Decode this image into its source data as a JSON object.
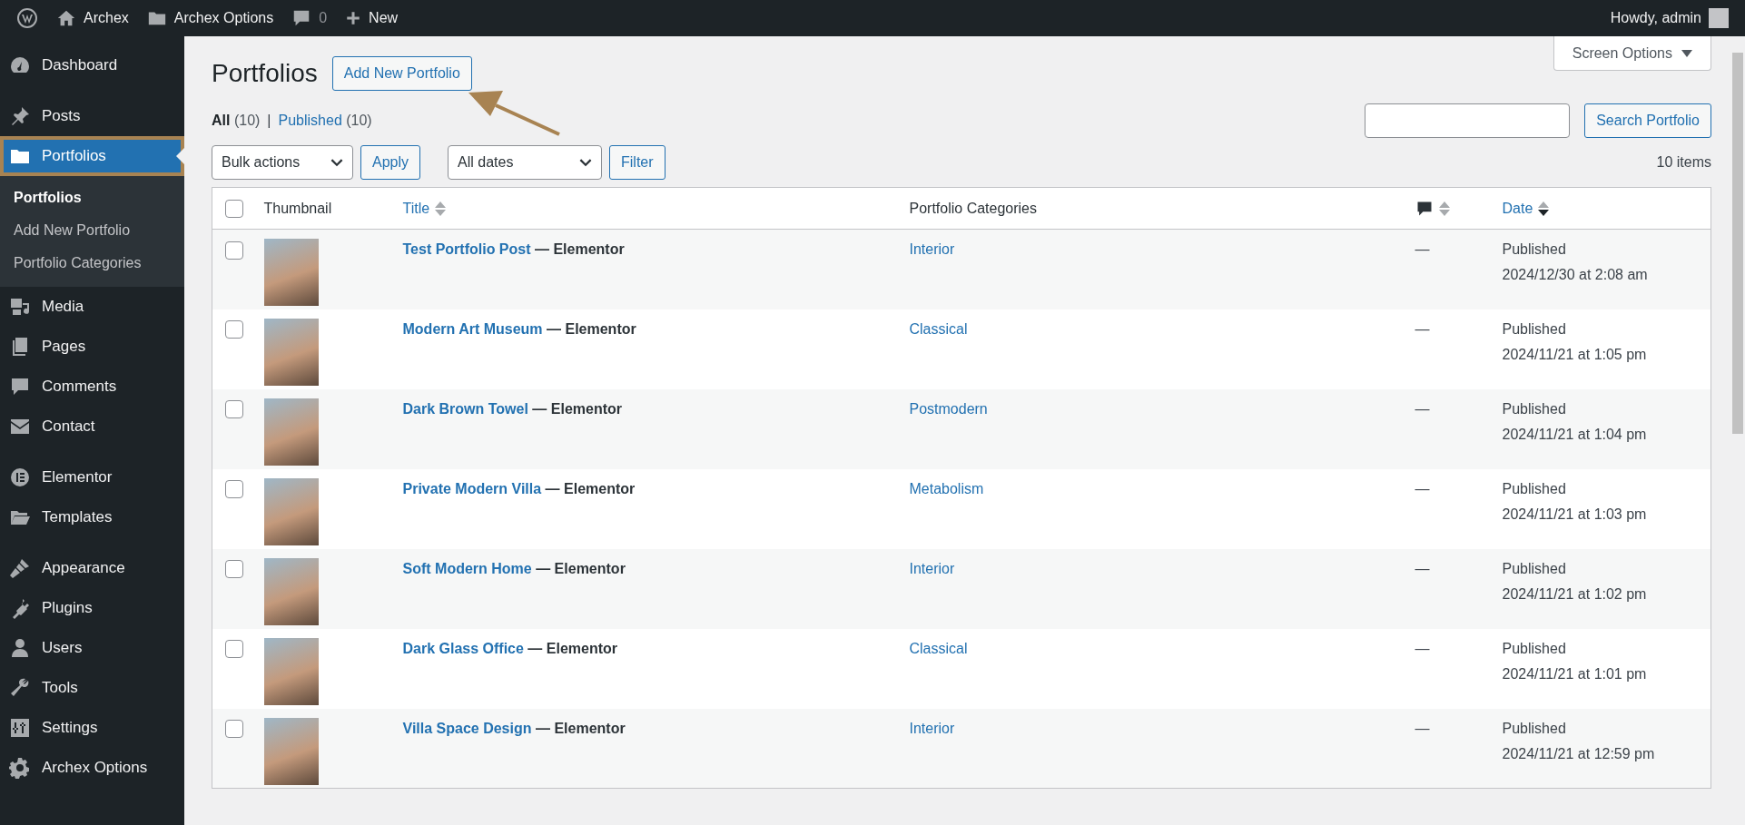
{
  "top_bar": {
    "items": [
      {
        "kind": "logo"
      },
      {
        "kind": "home",
        "label": "Archex"
      },
      {
        "kind": "folder",
        "label": "Archex Options"
      },
      {
        "kind": "comments",
        "label": "0"
      },
      {
        "kind": "new",
        "label": "New"
      }
    ],
    "greeting": "Howdy, admin"
  },
  "sidebar": {
    "groups": [
      [
        {
          "kind": "dashboard",
          "label": "Dashboard",
          "selected": false,
          "highlighted": false
        }
      ],
      [
        {
          "kind": "pin",
          "label": "Posts",
          "selected": false,
          "highlighted": false
        },
        {
          "kind": "folder",
          "label": "Portfolios",
          "selected": true,
          "highlighted": true,
          "children": [
            {
              "label": "Portfolios",
              "selected": true
            },
            {
              "label": "Add New Portfolio",
              "selected": false
            },
            {
              "label": "Portfolio Categories",
              "selected": false
            }
          ]
        },
        {
          "kind": "media",
          "label": "Media",
          "selected": false,
          "highlighted": false
        },
        {
          "kind": "pages",
          "label": "Pages",
          "selected": false,
          "highlighted": false
        },
        {
          "kind": "comments",
          "label": "Comments",
          "selected": false,
          "highlighted": false
        },
        {
          "kind": "mail",
          "label": "Contact",
          "selected": false,
          "highlighted": false
        }
      ],
      [
        {
          "kind": "elementor",
          "label": "Elementor",
          "selected": false,
          "highlighted": false
        },
        {
          "kind": "folder-open",
          "label": "Templates",
          "selected": false,
          "highlighted": false
        }
      ],
      [
        {
          "kind": "brush",
          "label": "Appearance",
          "selected": false,
          "highlighted": false
        },
        {
          "kind": "plug",
          "label": "Plugins",
          "selected": false,
          "highlighted": false
        },
        {
          "kind": "user",
          "label": "Users",
          "selected": false,
          "highlighted": false
        },
        {
          "kind": "wrench",
          "label": "Tools",
          "selected": false,
          "highlighted": false
        },
        {
          "kind": "sliders",
          "label": "Settings",
          "selected": false,
          "highlighted": false
        },
        {
          "kind": "gear",
          "label": "Archex Options",
          "selected": false,
          "highlighted": false
        }
      ]
    ]
  },
  "page": {
    "title": "Portfolios",
    "add_button": "Add New Portfolio",
    "screen_options": "Screen Options",
    "views": [
      {
        "label": "All",
        "count": "(10)",
        "selected": true
      },
      {
        "label": "Published",
        "count": "(10)",
        "selected": false
      }
    ],
    "view_separator": "|",
    "search_button": "Search Portfolio",
    "bulk_actions": "Bulk actions",
    "apply": "Apply",
    "date_filter": "All dates",
    "filter": "Filter",
    "items_count": "10 items"
  },
  "table": {
    "columns": [
      {
        "kind": "check",
        "checked": false
      },
      {
        "kind": "text",
        "label": "Thumbnail"
      },
      {
        "kind": "sortable",
        "label": "Title",
        "sorted": false
      },
      {
        "kind": "text",
        "label": "Portfolio Categories"
      },
      {
        "kind": "comments-icon",
        "sorted": false
      },
      {
        "kind": "sortable",
        "label": "Date",
        "sorted": true
      }
    ],
    "rows": [
      {
        "checked": false,
        "title": "Test Portfolio Post",
        "suffix": "— Elementor",
        "category": "Interior",
        "comments": "—",
        "status": "Published",
        "date": "2024/12/30 at 2:08 am"
      },
      {
        "checked": false,
        "title": "Modern Art Museum",
        "suffix": "— Elementor",
        "category": "Classical",
        "comments": "—",
        "status": "Published",
        "date": "2024/11/21 at 1:05 pm"
      },
      {
        "checked": false,
        "title": "Dark Brown Towel",
        "suffix": "— Elementor",
        "category": "Postmodern",
        "comments": "—",
        "status": "Published",
        "date": "2024/11/21 at 1:04 pm"
      },
      {
        "checked": false,
        "title": "Private Modern Villa",
        "suffix": "— Elementor",
        "category": "Metabolism",
        "comments": "—",
        "status": "Published",
        "date": "2024/11/21 at 1:03 pm"
      },
      {
        "checked": false,
        "title": "Soft Modern Home",
        "suffix": "— Elementor",
        "category": "Interior",
        "comments": "—",
        "status": "Published",
        "date": "2024/11/21 at 1:02 pm"
      },
      {
        "checked": false,
        "title": "Dark Glass Office",
        "suffix": "— Elementor",
        "category": "Classical",
        "comments": "—",
        "status": "Published",
        "date": "2024/11/21 at 1:01 pm"
      },
      {
        "checked": false,
        "title": "Villa Space Design",
        "suffix": "— Elementor",
        "category": "Interior",
        "comments": "—",
        "status": "Published",
        "date": "2024/11/21 at 12:59 pm"
      }
    ]
  }
}
